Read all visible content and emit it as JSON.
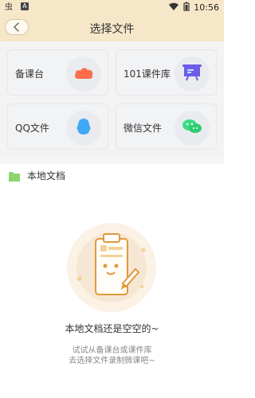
{
  "status_bar": {
    "time": "10:56",
    "app_icon": "bug-icon",
    "a_icon_label": "A",
    "icons": [
      "wifi-icon",
      "battery-icon"
    ]
  },
  "header": {
    "title": "选择文件",
    "back_icon": "chevron-left-icon",
    "bg_color": "#F6E7C9"
  },
  "sources": [
    {
      "label": "备课台",
      "icon": "cloud-icon",
      "color": "#FF6E4A"
    },
    {
      "label": "101课件库",
      "icon": "presentation-board-icon",
      "color": "#6C5CE7"
    },
    {
      "label": "QQ文件",
      "icon": "qq-penguin-icon",
      "color": "#3FA9F5"
    },
    {
      "label": "微信文件",
      "icon": "wechat-icon",
      "color": "#3DDC84"
    }
  ],
  "local": {
    "title": "本地文档",
    "folder_icon": "folder-icon",
    "folder_color": "#8BD46E"
  },
  "empty_state": {
    "title": "本地文档还是空空的~",
    "desc_line1": "试试从备课台或课件库",
    "desc_line2": "去选择文件录制微课吧~",
    "illustration": "clipboard-pen-illustration"
  }
}
